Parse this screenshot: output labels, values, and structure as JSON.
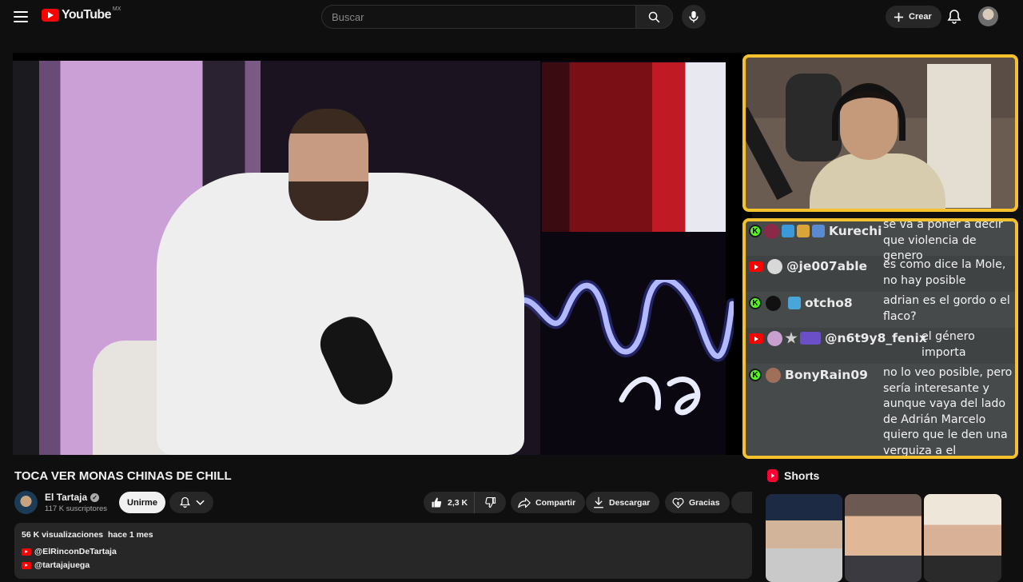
{
  "header": {
    "logo_text": "YouTube",
    "country": "MX",
    "search_placeholder": "Buscar",
    "create_label": "Crear"
  },
  "chat_overlay": {
    "messages": [
      {
        "platform": "kick",
        "user": "Kurechi",
        "text": "se va a poner a decir que violencia de genero"
      },
      {
        "platform": "youtube",
        "user": "@je007able",
        "text": "es como dice la Mole, no hay posible"
      },
      {
        "platform": "kick",
        "user": "otcho8",
        "text": "adrian es el gordo o el flaco?"
      },
      {
        "platform": "youtube",
        "user": "@n6t9y8_fenix",
        "text": "el género importa"
      },
      {
        "platform": "kick",
        "user": "BonyRain09",
        "text": "no lo veo posible, pero sería interesante y aunque vaya del lado de Adrián Marcelo quiero que le den una verguiza a el"
      }
    ]
  },
  "video": {
    "title": "TOCA VER MONAS CHINAS DE CHILL",
    "channel_name": "El Tartaja",
    "subscribers": "117 K suscriptores",
    "join_label": "Unirme",
    "likes": "2,3 K",
    "share_label": "Compartir",
    "download_label": "Descargar",
    "thanks_label": "Gracias"
  },
  "description": {
    "views": "56 K visualizaciones",
    "date": "hace 1 mes",
    "links": [
      "@ElRinconDeTartaja",
      "@tartajajuega"
    ]
  },
  "sidebar": {
    "shorts_label": "Shorts"
  },
  "colors": {
    "background": "#0f0f0f",
    "overlay_border": "#f5c22d",
    "kick_green": "#53fc18",
    "youtube_red": "#ff0000"
  }
}
